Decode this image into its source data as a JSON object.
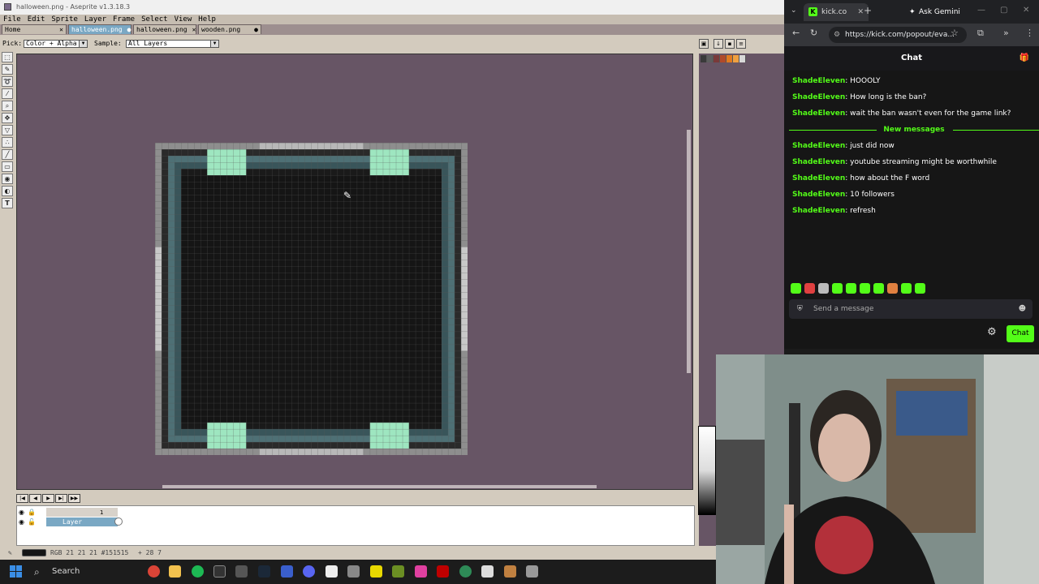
{
  "app": {
    "title": "halloween.png - Aseprite v1.3.18.3",
    "menu": [
      "File",
      "Edit",
      "Sprite",
      "Layer",
      "Frame",
      "Select",
      "View",
      "Help"
    ],
    "tabs": [
      {
        "label": "Home",
        "active": false
      },
      {
        "label": "halloween.png",
        "active": true
      },
      {
        "label": "halloween.png",
        "active": false
      },
      {
        "label": "wooden.png",
        "active": false
      }
    ],
    "context": {
      "pick_label": "Pick:",
      "pick_value": "Color + Alpha",
      "sample_label": "Sample:",
      "sample_value": "All Layers"
    },
    "tools": [
      "rectangular-marquee",
      "pencil",
      "lasso",
      "eyedropper",
      "zoom",
      "move",
      "paint-bucket",
      "spray",
      "line",
      "rectangle",
      "blur",
      "contour",
      "text"
    ],
    "timeline": {
      "layer_name": "Layer",
      "frame_number": "1"
    },
    "status": {
      "color": "RGB 21 21 21 #151515",
      "position": "+ 28 7"
    },
    "palette_colors": [
      "#3a3a3a",
      "#5e5e5e",
      "#7a3a3a",
      "#b04a2a",
      "#e07a20",
      "#f0a040",
      "#d8d8d8"
    ],
    "canvas_bg": "#675565"
  },
  "browser": {
    "tab_title": "kick.co",
    "ask_gemini": "Ask Gemini",
    "url": "https://kick.com/popout/eva...",
    "chat_title": "Chat",
    "messages": [
      {
        "user": "ShadeEleven",
        "text": "HOOOLY"
      },
      {
        "user": "ShadeEleven",
        "text": "How long is the ban?"
      },
      {
        "user": "ShadeEleven",
        "text": "wait the ban wasn't even for the game link?"
      }
    ],
    "new_messages_label": "New messages",
    "new_msgs": [
      {
        "user": "ShadeEleven",
        "text": "just did now"
      },
      {
        "user": "ShadeEleven",
        "text": "youtube streaming might be worthwhile"
      },
      {
        "user": "ShadeEleven",
        "text": "how about the F word"
      },
      {
        "user": "ShadeEleven",
        "text": "10 followers"
      },
      {
        "user": "ShadeEleven",
        "text": "refresh"
      }
    ],
    "input_placeholder": "Send a message",
    "send_label": "Chat",
    "accent": "#53fc18"
  },
  "taskbar": {
    "search_label": "Search"
  }
}
